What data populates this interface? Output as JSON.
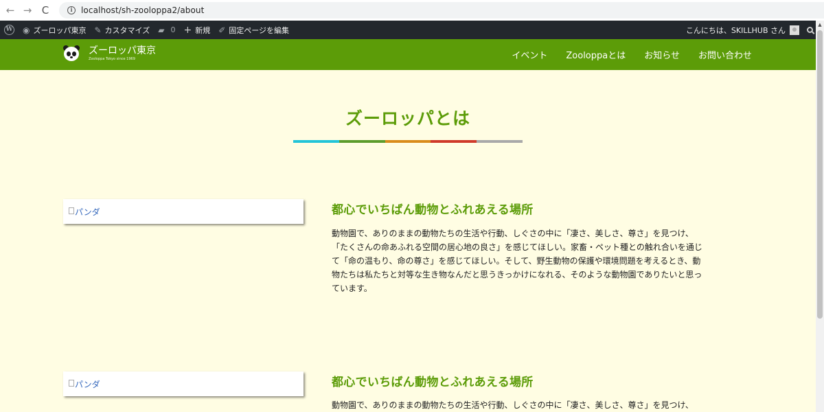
{
  "browser": {
    "url": "localhost/sh-zooloppa2/about",
    "back_icon": "←",
    "forward_icon": "→",
    "reload_icon": "C",
    "info_icon": "i"
  },
  "adminbar": {
    "wp_logo": "W",
    "site_name": "ズーロッパ東京",
    "customize": "カスタマイズ",
    "comments_count": "0",
    "new": "新規",
    "edit_page": "固定ページを編集",
    "greeting": "こんにちは、SKILLHUB さん"
  },
  "header": {
    "logo_title": "ズーロッパ東京",
    "logo_sub": "Zooloppa Tokyo since 1969",
    "nav": [
      {
        "label": "イベント"
      },
      {
        "label": "Zooloppaとは"
      },
      {
        "label": "お知らせ"
      },
      {
        "label": "お問い合わせ"
      }
    ]
  },
  "main": {
    "title": "ズーロッパとは",
    "title_bar_colors": [
      "#23c4d8",
      "#5c9c2c",
      "#d98c1c",
      "#cf3a2a",
      "#a9a9a9"
    ],
    "sections": [
      {
        "image_alt": "パンダ",
        "heading": "都心でいちばん動物とふれあえる場所",
        "lines": [
          "動物園で、ありのままの動物たちの生活や行動、しぐさの中に「凄さ、美しさ、尊さ」を見つけ、",
          "「たくさんの命あふれる空間の居心地の良さ」を感じてほしい。家畜・ペット種との触れ合いを通じ",
          "て「命の温もり、命の尊さ」を感じてほしい。そして、野生動物の保護や環境問題を考えるとき、動",
          "物たちは私たちと対等な生き物なんだと思うきっかけになれる、そのような動物園でありたいと思っ",
          "ています。"
        ]
      },
      {
        "image_alt": "パンダ",
        "heading": "都心でいちばん動物とふれあえる場所",
        "lines": [
          "動物園で、ありのままの動物たちの生活や行動、しぐさの中に「凄さ、美しさ、尊さ」を見つけ、"
        ]
      }
    ]
  },
  "colors": {
    "brand_green": "#5c9c08",
    "page_bg": "#fffde3",
    "adminbar_bg": "#23282d",
    "link": "#3366bb"
  }
}
